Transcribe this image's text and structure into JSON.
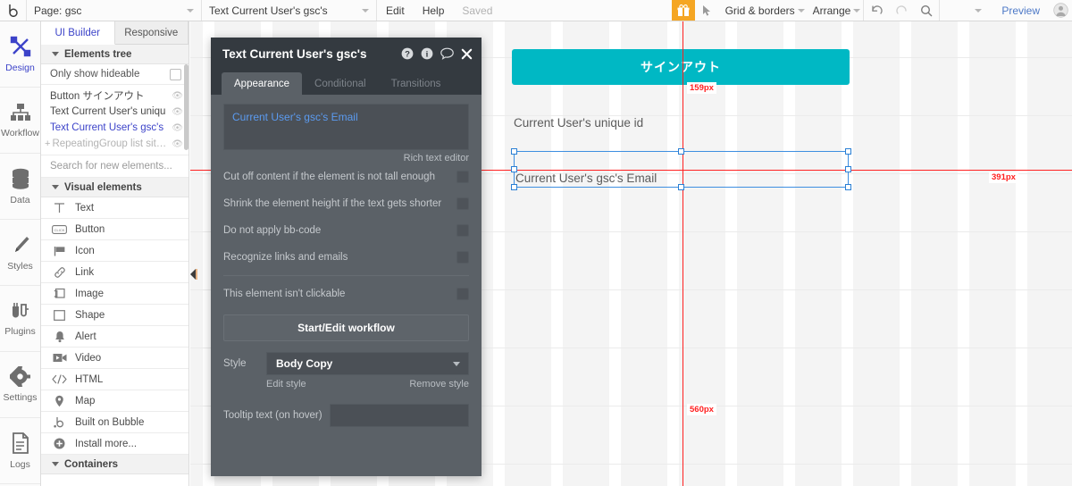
{
  "topbar": {
    "logo": "bubble-logo-icon",
    "page_select": {
      "label": "Page: gsc",
      "caret": "chevron-down-icon"
    },
    "element_select": {
      "label": "Text Current User's gsc's",
      "caret": "chevron-down-icon"
    },
    "edit": "Edit",
    "help": "Help",
    "saved": "Saved",
    "gift": "gift-icon",
    "pointer": "pointer-icon",
    "grid_borders": "Grid & borders",
    "arrange": "Arrange",
    "undo": "undo-icon",
    "redo": "redo-icon",
    "search": "search-icon",
    "more_caret": "chevron-down-icon",
    "preview": "Preview",
    "avatar": "user-avatar-icon"
  },
  "rail": {
    "items": [
      {
        "label": "Design",
        "icon": "design-icon",
        "active": true
      },
      {
        "label": "Workflow",
        "icon": "workflow-icon",
        "active": false
      },
      {
        "label": "Data",
        "icon": "data-icon",
        "active": false
      },
      {
        "label": "Styles",
        "icon": "styles-icon",
        "active": false
      },
      {
        "label": "Plugins",
        "icon": "plugins-icon",
        "active": false
      },
      {
        "label": "Settings",
        "icon": "settings-gear-icon",
        "active": false
      },
      {
        "label": "Logs",
        "icon": "logs-icon",
        "active": false
      }
    ]
  },
  "panel": {
    "tabs": [
      {
        "label": "UI Builder",
        "active": true
      },
      {
        "label": "Responsive",
        "active": false
      }
    ],
    "elements_tree_header": "Elements tree",
    "only_show_hideable": "Only show hideable",
    "tree": [
      {
        "label": "Button サインアウト",
        "selected": false,
        "dim": false
      },
      {
        "label": "Text Current User's uniqu",
        "selected": false,
        "dim": false
      },
      {
        "label": "Text Current User's gsc's",
        "selected": true,
        "dim": false
      },
      {
        "label": "RepeatingGroup list siteEnt...",
        "selected": false,
        "dim": true
      }
    ],
    "search_placeholder": "Search for new elements...",
    "visual_elements_header": "Visual elements",
    "elements": [
      {
        "label": "Text",
        "icon": "text-t-icon"
      },
      {
        "label": "Button",
        "icon": "button-icon"
      },
      {
        "label": "Icon",
        "icon": "flag-icon"
      },
      {
        "label": "Link",
        "icon": "link-chain-icon"
      },
      {
        "label": "Image",
        "icon": "image-icon"
      },
      {
        "label": "Shape",
        "icon": "shape-square-icon"
      },
      {
        "label": "Alert",
        "icon": "alert-bell-icon"
      },
      {
        "label": "Video",
        "icon": "video-camera-icon"
      },
      {
        "label": "HTML",
        "icon": "html-code-icon"
      },
      {
        "label": "Map",
        "icon": "map-pin-icon"
      },
      {
        "label": "Built on Bubble",
        "icon": "bubble-b-icon"
      },
      {
        "label": "Install more...",
        "icon": "plus-circle-icon"
      }
    ],
    "containers_header": "Containers",
    "collapse_arrow": "collapse-left-arrow-icon"
  },
  "property_editor": {
    "title": "Text Current User's gsc's",
    "title_icons": [
      {
        "name": "help-question-icon",
        "glyph": "?"
      },
      {
        "name": "info-icon",
        "glyph": "i"
      },
      {
        "name": "comment-icon",
        "glyph": "comment"
      },
      {
        "name": "close-icon",
        "glyph": "close"
      }
    ],
    "tabs": [
      {
        "label": "Appearance",
        "active": true
      },
      {
        "label": "Conditional",
        "active": false
      },
      {
        "label": "Transitions",
        "active": false
      }
    ],
    "content_value": "Current User's gsc's Email",
    "rich_text_editor_link": "Rich text editor",
    "options": [
      {
        "label": "Cut off content if the element is not tall enough",
        "checked": false
      },
      {
        "label": "Shrink the element height if the text gets shorter",
        "checked": false
      },
      {
        "label": "Do not apply bb-code",
        "checked": false
      },
      {
        "label": "Recognize links and emails",
        "checked": false
      }
    ],
    "clickable_option": {
      "label": "This element isn't clickable",
      "checked": false
    },
    "workflow_button": "Start/Edit workflow",
    "style_label": "Style",
    "style_value": "Body Copy",
    "edit_style": "Edit style",
    "remove_style": "Remove style",
    "tooltip_label": "Tooltip text (on hover)",
    "tooltip_value": ""
  },
  "canvas": {
    "signout_button": {
      "label": "サインアウト",
      "color": "#00b8c4"
    },
    "texts": [
      {
        "label": "Current User's unique id"
      },
      {
        "label": "Current User's gsc's Email"
      }
    ],
    "guides": {
      "color": "#ff2020",
      "labels": [
        {
          "value": "159px",
          "name": "top-distance-label"
        },
        {
          "value": "391px",
          "name": "right-distance-label"
        },
        {
          "value": "560px",
          "name": "bottom-distance-label"
        }
      ]
    },
    "selection": {
      "color": "#3d8ee0",
      "handles": 8
    }
  }
}
